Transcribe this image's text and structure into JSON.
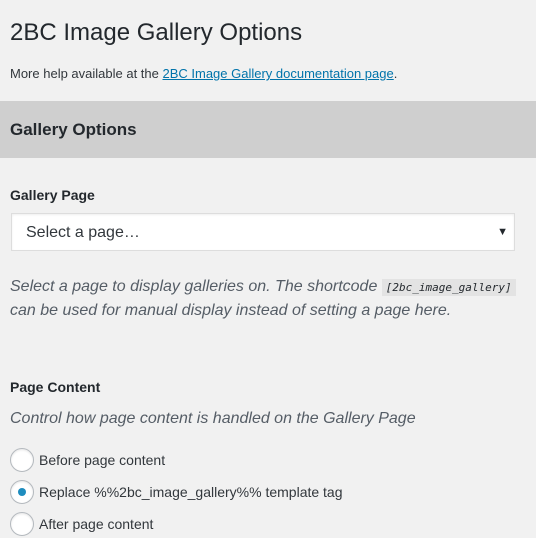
{
  "page": {
    "title": "2BC Image Gallery Options",
    "help_prefix": "More help available at the ",
    "help_link": "2BC Image Gallery documentation page",
    "help_suffix": "."
  },
  "section": {
    "title": "Gallery Options"
  },
  "gallery_page": {
    "label": "Gallery Page",
    "select_value": "Select a page…",
    "desc_before": "Select a page to display galleries on. The shortcode ",
    "shortcode": "[2bc_image_gallery]",
    "desc_after": " can be used for manual display instead of setting a page here."
  },
  "page_content": {
    "label": "Page Content",
    "description": "Control how page content is handled on the Gallery Page",
    "options": [
      {
        "label": "Before page content",
        "checked": false
      },
      {
        "label": "Replace %%2bc_image_gallery%% template tag",
        "checked": true
      },
      {
        "label": "After page content",
        "checked": false
      }
    ]
  },
  "colors": {
    "link": "#0073aa",
    "radio_checked": "#1e8cbe",
    "section_header_bg": "#cfcfcf",
    "page_bg": "#f1f1f1"
  }
}
